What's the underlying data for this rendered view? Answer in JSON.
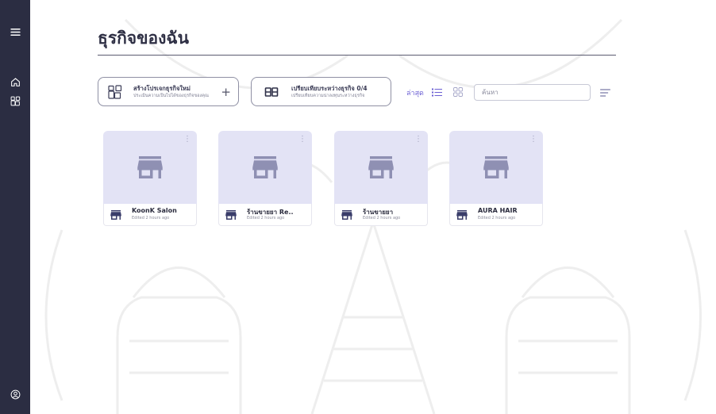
{
  "sidebar": {
    "menu_icon": "menu-icon",
    "items": [
      {
        "icon": "home-icon"
      },
      {
        "icon": "apps-icon"
      }
    ],
    "bottom_icon": "user-circle-icon"
  },
  "page": {
    "title": "ธุรกิจของฉัน"
  },
  "actions": {
    "create": {
      "icon": "apps-add-icon",
      "title": "สร้างโปรเจกธุรกิจใหม่",
      "subtitle": "ประเมินความเป็นไปได้ของธุรกิจของคุณ",
      "plus": "+"
    },
    "compare": {
      "icon": "compare-icon",
      "title": "เปรียบเทียบระหว่างธุรกิจ 0/4",
      "subtitle": "เปรียบเทียบความน่าลงทุนระหว่างธุรกิจ"
    }
  },
  "toolbar": {
    "sort_label": "ล่าสุด",
    "list_view_icon": "list-view-icon",
    "grid_view_icon": "grid-view-icon",
    "search_placeholder": "ค้นหา",
    "sort_icon": "sort-icon"
  },
  "projects": [
    {
      "icon": "store-icon",
      "name": "KoonK Salon",
      "edited": "Edited 2 hours ago"
    },
    {
      "icon": "store-icon",
      "name": "ร้านขายยา Re..",
      "edited": "Edited 2 hours ago"
    },
    {
      "icon": "store-icon",
      "name": "ร้านขายยา",
      "edited": "Edited 2 hours ago"
    },
    {
      "icon": "store-icon",
      "name": "AURA HAIR",
      "edited": "Edited 2 hours ago"
    }
  ],
  "colors": {
    "sidebar": "#2b2d42",
    "accent": "#6b5fd3",
    "thumbnail": "#e3e3f5",
    "thumbnail_icon": "#8f90b3",
    "card_icon": "#3a3d6a",
    "text": "#2e2f44"
  }
}
